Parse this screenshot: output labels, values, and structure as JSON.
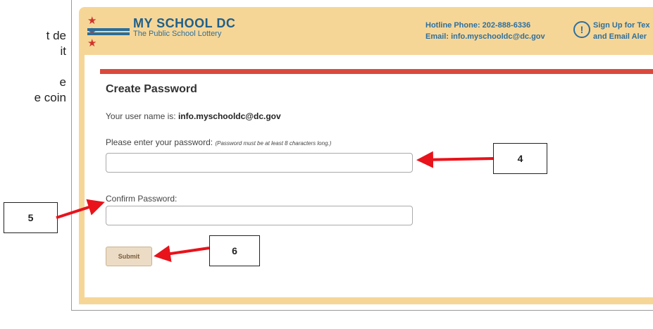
{
  "side_text": [
    "t de",
    "it",
    "e",
    "e coin"
  ],
  "header": {
    "stars": "★ ★ ★",
    "logo_title": "MY SCHOOL DC",
    "logo_subtitle": "The Public School Lottery",
    "hotline": "Hotline Phone: 202-888-6336",
    "email": "Email: info.myschooldc@dc.gov",
    "signup_line1": "Sign Up for Tex",
    "signup_line2": "and Email Aler",
    "signup_icon": "exclamation-circle-icon"
  },
  "form": {
    "title": "Create Password",
    "username_prefix": "Your user name is:",
    "username": "info.myschooldc@dc.gov",
    "password_label": "Please enter your password:",
    "password_hint": "(Password must be at least 8 characters long.)",
    "password_value": "",
    "confirm_label": "Confirm Password:",
    "confirm_value": "",
    "submit_label": "Submit"
  },
  "callouts": {
    "c4": "4",
    "c5": "5",
    "c6": "6"
  },
  "colors": {
    "header_bg": "#f6d697",
    "accent_red": "#d94a3c",
    "brand_blue": "#1f5f8b",
    "arrow_red": "#e8131b"
  }
}
